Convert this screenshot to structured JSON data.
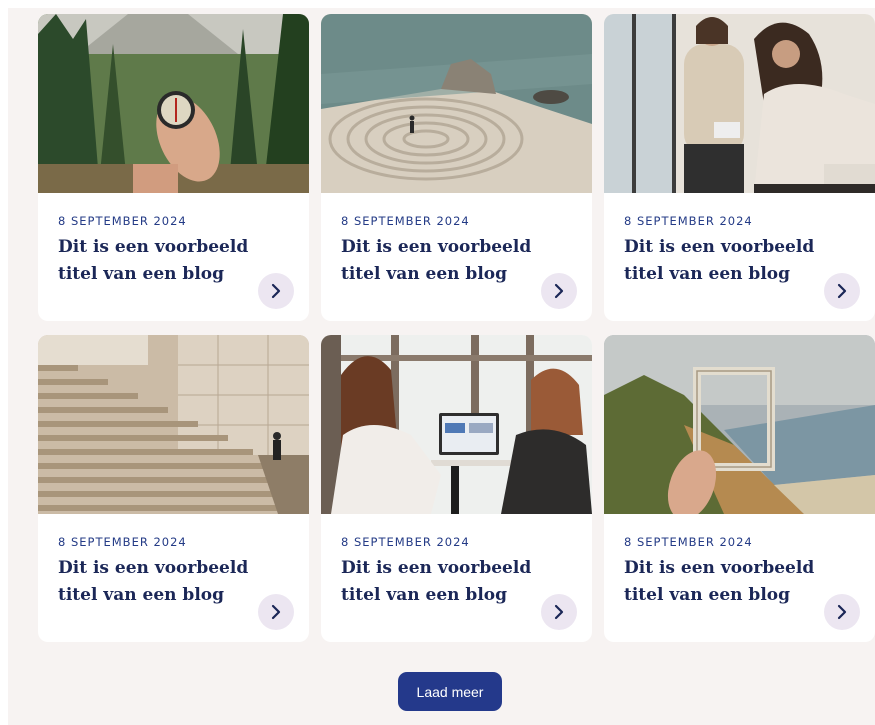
{
  "cards": [
    {
      "date": "8 SEPTEMBER 2024",
      "title": "Dit is een voorbeeld titel van een blog",
      "image": "hand-holding-compass-forest"
    },
    {
      "date": "8 SEPTEMBER 2024",
      "title": "Dit is een voorbeeld titel van een blog",
      "image": "person-walking-beach-labyrinth"
    },
    {
      "date": "8 SEPTEMBER 2024",
      "title": "Dit is een voorbeeld titel van een blog",
      "image": "two-women-in-meeting"
    },
    {
      "date": "8 SEPTEMBER 2024",
      "title": "Dit is een voorbeeld titel van een blog",
      "image": "stone-staircase"
    },
    {
      "date": "8 SEPTEMBER 2024",
      "title": "Dit is een voorbeeld titel van een blog",
      "image": "two-women-at-laptop"
    },
    {
      "date": "8 SEPTEMBER 2024",
      "title": "Dit is een voorbeeld titel van een blog",
      "image": "hand-holding-frame-coast"
    }
  ],
  "load_more": {
    "label": "Laad meer"
  },
  "colors": {
    "section_bg": "#f7f3f2",
    "card_bg": "#ffffff",
    "date": "#243b86",
    "title": "#1b2757",
    "arrow_bg": "#ece6f1",
    "arrow_icon": "#1b2757",
    "button_bg": "#24398b"
  },
  "icons": {
    "card_arrow": "chevron-right-icon"
  }
}
